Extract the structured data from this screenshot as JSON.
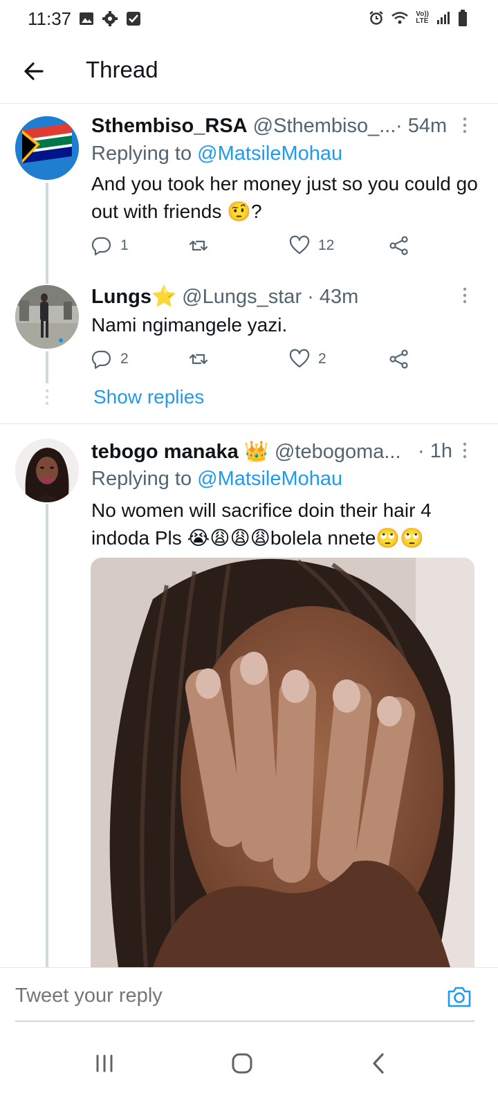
{
  "status_bar": {
    "time": "11:37",
    "left_icons": [
      "image-icon",
      "gear-icon",
      "checkbox-icon"
    ],
    "right_icons": [
      "alarm-icon",
      "wifi-icon",
      "volte-icon",
      "signal-icon",
      "battery-icon"
    ],
    "volte_text_top": "Vo))",
    "volte_text_bottom": "LTE"
  },
  "header": {
    "title": "Thread"
  },
  "tweets": [
    {
      "name": "Sthembiso_RSA",
      "handle": "@Sthembiso_...",
      "time": "· 54m",
      "replying_prefix": "Replying to ",
      "replying_to": "@MatsileMohau",
      "text": "And you took her money just so you could go out with friends 🤨?",
      "replies": "1",
      "retweets": "",
      "likes": "12"
    },
    {
      "name": "Lungs⭐",
      "handle": "@Lungs_star · 43m",
      "text": "Nami ngimangele yazi.",
      "replies": "2",
      "retweets": "",
      "likes": "2",
      "show_replies": "Show replies"
    },
    {
      "name": "tebogo manaka 👑",
      "handle": "@tebogoma...",
      "time": "· 1h",
      "replying_prefix": "Replying to ",
      "replying_to": "@MatsileMohau",
      "text": "No women will sacrifice doin their hair 4 indoda Pls 😭😩😩😩bolela nnete🙄🙄"
    }
  ],
  "reply_bar": {
    "placeholder": "Tweet your reply"
  },
  "colors": {
    "accent": "#1d9bf0",
    "text": "#0f1419",
    "secondary": "#536471",
    "thread_line": "#cfd9de"
  }
}
